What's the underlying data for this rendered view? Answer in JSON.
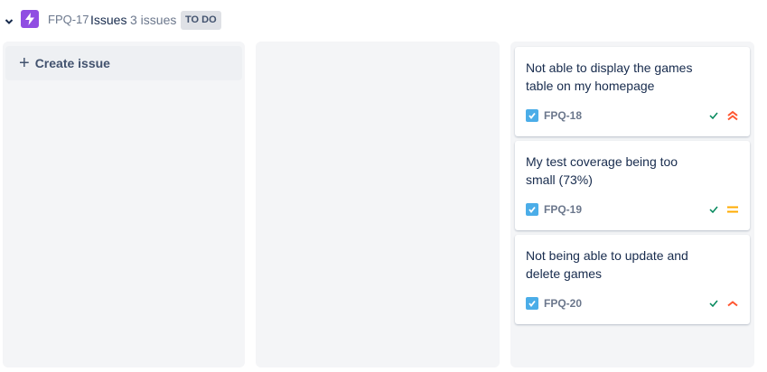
{
  "epic": {
    "key": "FPQ-17",
    "title": "Issues",
    "count": "3 issues",
    "status": "TO DO",
    "color": "#904ee2"
  },
  "columns": [
    {
      "create_label": "Create issue"
    },
    {},
    {
      "cards": [
        {
          "summary": "Not able to display the games table on my homepage",
          "key": "FPQ-18",
          "priority": "highest",
          "priority_color": "#ff5630"
        },
        {
          "summary": "My test coverage being too small (73%)",
          "key": "FPQ-19",
          "priority": "medium",
          "priority_color": "#ffab00"
        },
        {
          "summary": "Not being able to update and delete games",
          "key": "FPQ-20",
          "priority": "high",
          "priority_color": "#ff5630"
        }
      ]
    }
  ]
}
